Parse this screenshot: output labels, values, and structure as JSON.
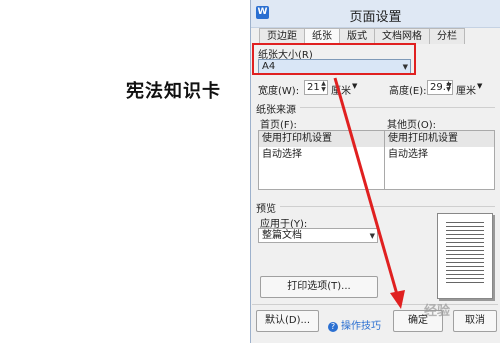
{
  "document": {
    "title": "宪法知识卡"
  },
  "dialog": {
    "icon_letter": "W",
    "title": "页面设置",
    "tabs": [
      "页边距",
      "纸张",
      "版式",
      "文档网格",
      "分栏"
    ],
    "paper_size": {
      "label": "纸张大小(R)",
      "value": "A4"
    },
    "width": {
      "label": "宽度(W):",
      "value": "21",
      "unit": "厘米"
    },
    "height": {
      "label": "高度(E):",
      "value": "29.7",
      "unit": "厘米"
    },
    "paper_source": {
      "label": "纸张来源",
      "first_page_label": "首页(F):",
      "other_pages_label": "其他页(O):",
      "first_page_items": [
        "使用打印机设置",
        "自动选择"
      ],
      "other_pages_items": [
        "使用打印机设置",
        "自动选择"
      ]
    },
    "preview": {
      "label": "预览",
      "apply_to_label": "应用于(Y):",
      "apply_to_value": "整篇文档"
    },
    "print_options_button": "打印选项(T)...",
    "default_button": "默认(D)...",
    "tips_link": "操作技巧",
    "ok_button": "确定",
    "cancel_button": "取消",
    "watermark": "经验"
  },
  "colors": {
    "highlight_box": "#e02020",
    "arrow": "#e02020",
    "accent": "#2a6fd1"
  }
}
